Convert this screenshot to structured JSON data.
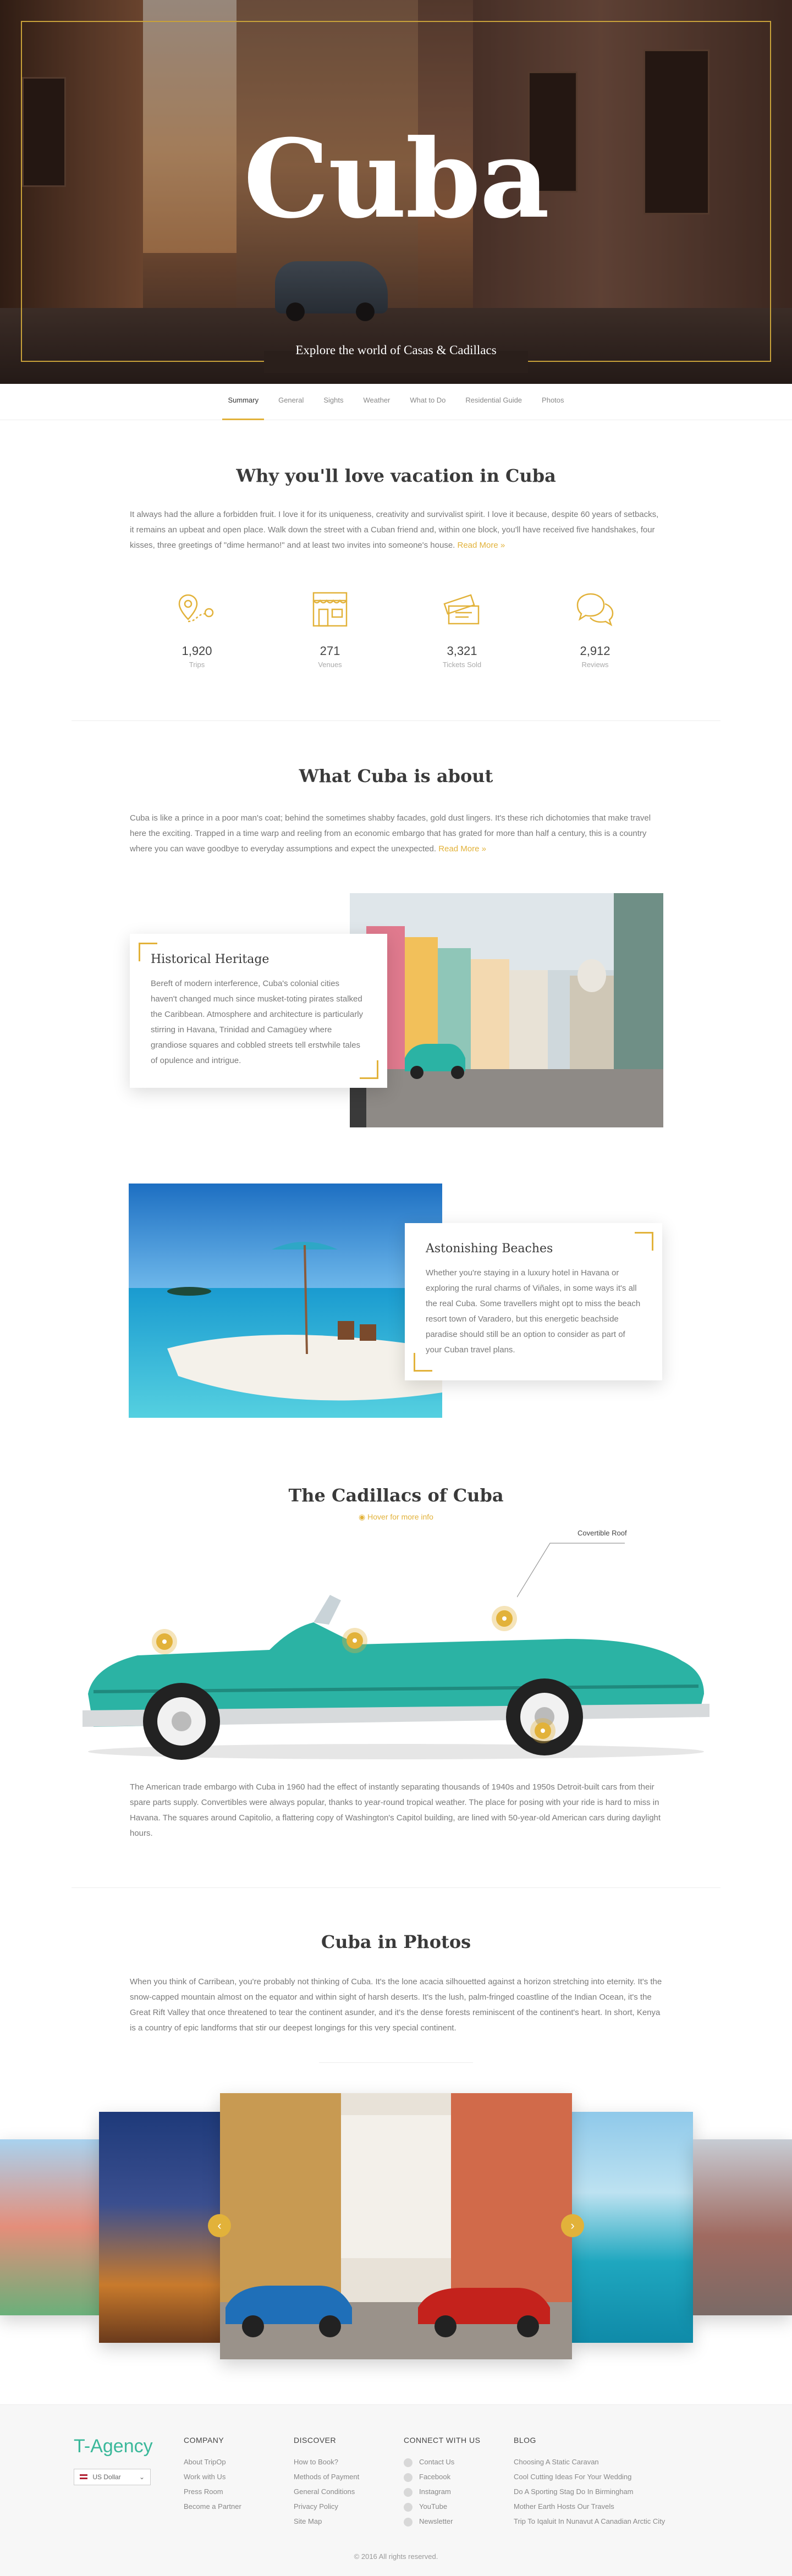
{
  "hero": {
    "title": "Cuba",
    "tagline": "Explore the world of Casas & Cadillacs"
  },
  "tabs": [
    {
      "label": "Summary",
      "active": true
    },
    {
      "label": "General"
    },
    {
      "label": "Sights"
    },
    {
      "label": "Weather"
    },
    {
      "label": "What to Do"
    },
    {
      "label": "Residential Guide"
    },
    {
      "label": "Photos"
    }
  ],
  "love": {
    "heading": "Why you'll love vacation in Cuba",
    "body": "It always had the allure a forbidden fruit. I love it for its uniqueness, creativity and survivalist spirit. I love it because, despite 60 years of setbacks, it remains an upbeat and open place. Walk down the street with a Cuban friend and, within one block, you'll have received five handshakes, four kisses, three greetings of \"dime hermano!\" and at least two invites into someone's house.",
    "read_more": "Read More »"
  },
  "stats": [
    {
      "icon": "map-pin-route-icon",
      "value": "1,920",
      "label": "Trips"
    },
    {
      "icon": "storefront-icon",
      "value": "271",
      "label": "Venues"
    },
    {
      "icon": "tickets-icon",
      "value": "3,321",
      "label": "Tickets Sold"
    },
    {
      "icon": "chat-bubbles-icon",
      "value": "2,912",
      "label": "Reviews"
    }
  ],
  "about": {
    "heading": "What Cuba is about",
    "body": "Cuba is like a prince in a poor man's coat; behind the sometimes shabby facades, gold dust lingers. It's these rich dichotomies that make travel here the exciting. Trapped in a time warp and reeling from an economic embargo that has grated for more than half a century, this is a country where you can wave goodbye to everyday assumptions and expect the unexpected.",
    "read_more": "Read More »"
  },
  "heritage": {
    "title": "Historical Heritage",
    "body": "Bereft of modern interference, Cuba's colonial cities haven't changed much since musket-toting pirates stalked the Caribbean. Atmosphere and architecture is particularly stirring in Havana, Trinidad and Camagüey where grandiose squares and cobbled streets tell erstwhile tales of opulence and intrigue."
  },
  "beaches": {
    "title": "Astonishing Beaches",
    "body": "Whether you're staying in a luxury hotel in Havana or exploring the rural charms of Viñales, in some ways it's all the real Cuba. Some travellers might opt to miss the beach resort town of Varadero, but this energetic beachside paradise should still be an option to consider as part of your Cuban travel plans."
  },
  "cadillacs": {
    "heading": "The Cadillacs of Cuba",
    "hint": "Hover for more info",
    "callout": "Covertible Roof",
    "body": "The American trade embargo with Cuba in 1960 had the effect of instantly separating thousands of 1940s and 1950s Detroit-built cars from their spare parts supply. Convertibles were always popular, thanks to year-round tropical weather. The place for posing with your ride is hard to miss in Havana. The squares around Capitolio, a flattering copy of Washington's Capitol building, are lined with 50-year-old American cars during daylight hours."
  },
  "photos": {
    "heading": "Cuba in Photos",
    "body": "When you think of Carribean, you're probably not thinking of Cuba. It's the lone acacia silhouetted against a horizon stretching into eternity. It's the snow-capped mountain almost on the equator and within sight of harsh deserts. It's the lush, palm-fringed coastline of the Indian Ocean, it's the Great Rift Valley that once threatened to tear the continent asunder, and it's the dense forests reminiscent of the continent's heart. In short, Kenya is a country of epic landforms that stir our deepest longings for this very special continent.",
    "prev": "‹",
    "next": "›"
  },
  "footer": {
    "brand": "T-Agency",
    "currency": "US Dollar",
    "columns": [
      {
        "title": "COMPANY",
        "items": [
          "About TripOp",
          "Work with Us",
          "Press Room",
          "Become a Partner"
        ]
      },
      {
        "title": "DISCOVER",
        "items": [
          "How to Book?",
          "Methods of Payment",
          "General Conditions",
          "Privacy Policy",
          "Site Map"
        ]
      },
      {
        "title": "CONNECT WITH US",
        "items": [
          "Contact Us",
          "Facebook",
          "Instagram",
          "YouTube",
          "Newsletter"
        ]
      },
      {
        "title": "BLOG",
        "items": [
          "Choosing A Static Caravan",
          "Cool Cutting Ideas For Your Wedding",
          "Do A Sporting Stag Do In Birmingham",
          "Mother Earth Hosts Our Travels",
          "Trip To Iqaluit In Nunavut A Canadian Arctic City"
        ]
      }
    ],
    "copyright": "© 2016 All rights reserved."
  },
  "colors": {
    "accent": "#e2b23a",
    "brand": "#3ab89a",
    "car": "#2bb3a4"
  }
}
